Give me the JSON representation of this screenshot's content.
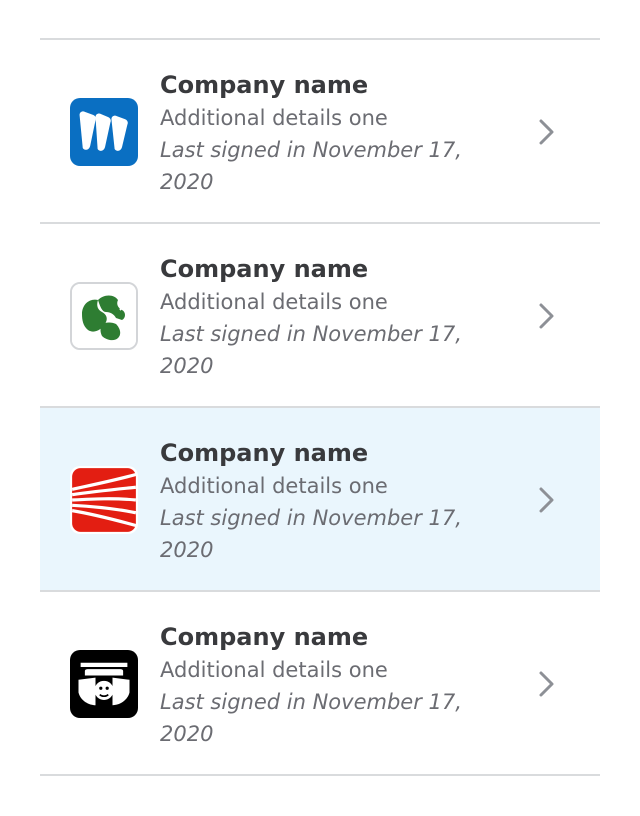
{
  "companies": [
    {
      "name": "Company name",
      "details": "Additional details one",
      "last_signed": "Last signed in November 17, 2020",
      "logo_icon": "wb-logo-icon",
      "logo_color": "#0a6fc2",
      "selected": false
    },
    {
      "name": "Company name",
      "details": "Additional details one",
      "last_signed": "Last signed in November 17, 2020",
      "logo_icon": "trefoil-logo-icon",
      "logo_color": "#2e7d32",
      "selected": false
    },
    {
      "name": "Company name",
      "details": "Additional details one",
      "last_signed": "Last signed in November 17, 2020",
      "logo_icon": "red-stripes-logo-icon",
      "logo_color": "#e31e12",
      "selected": true
    },
    {
      "name": "Company name",
      "details": "Additional details one",
      "last_signed": "Last signed in November 17, 2020",
      "logo_icon": "black-emblem-logo-icon",
      "logo_color": "#000000",
      "selected": false
    }
  ],
  "colors": {
    "divider": "#d9dbdd",
    "selected_bg": "#eaf6fd",
    "title": "#393a3d",
    "secondary": "#6b6c72",
    "chevron": "#8d9096"
  }
}
